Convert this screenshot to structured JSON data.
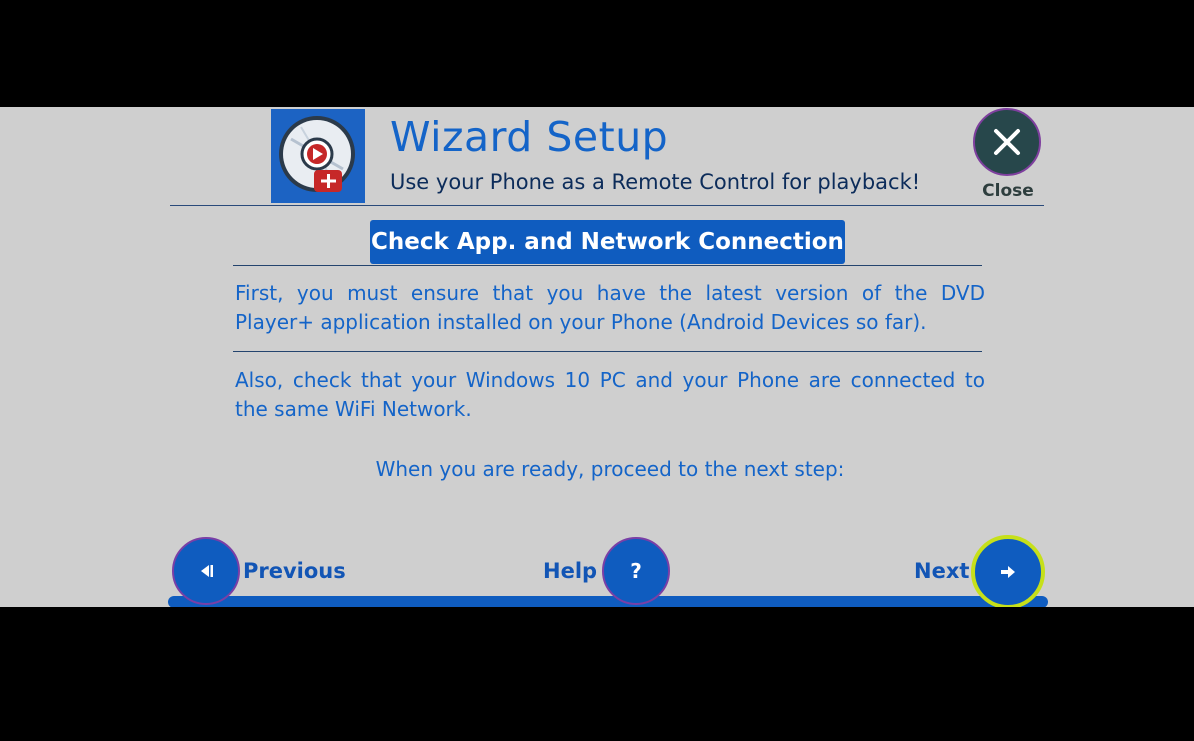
{
  "header": {
    "title": "Wizard Setup",
    "subtitle": "Use your Phone as a Remote Control for playback!",
    "close_label": "Close",
    "logo_icon": "dvd-player-plus-logo-icon"
  },
  "content": {
    "heading": "Check App. and Network Connection",
    "paragraph1": "First, you must ensure that you have the latest version of the DVD Player+ application installed on your Phone (Android Devices so far).",
    "paragraph2": "Also, check that your Windows 10 PC and your Phone are connected to the same WiFi Network.",
    "ready_text": "When you are ready, proceed to the next step:"
  },
  "nav": {
    "previous_label": "Previous",
    "help_label": "Help",
    "help_glyph": "?",
    "next_label": "Next"
  },
  "colors": {
    "accent": "#0f5cbf",
    "text_blue": "#1464c8",
    "panel_bg": "#cfcfcf",
    "next_highlight": "#c6e01a"
  }
}
